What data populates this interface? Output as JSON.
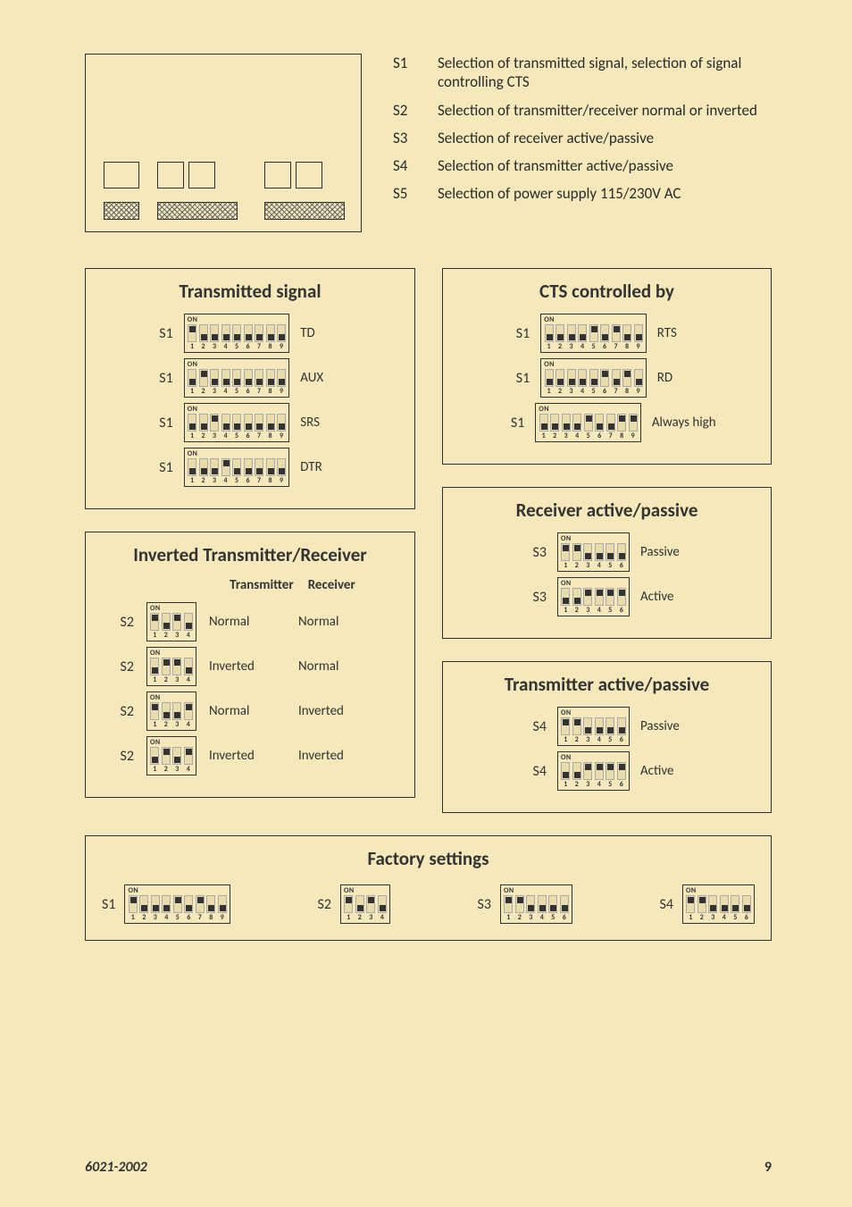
{
  "descriptions": [
    {
      "key": "S1",
      "text": "Selection of transmitted signal, selection of signal controlling CTS"
    },
    {
      "key": "S2",
      "text": "Selection of transmitter/receiver normal or inverted"
    },
    {
      "key": "S3",
      "text": "Selection of receiver active/passive"
    },
    {
      "key": "S4",
      "text": "Selection of transmitter active/passive"
    },
    {
      "key": "S5",
      "text": "Selection of power supply 115/230V AC"
    }
  ],
  "transmitted": {
    "title": "Transmitted signal",
    "rows": [
      {
        "label": "S1",
        "pattern": [
          1,
          0,
          0,
          0,
          0,
          0,
          0,
          0,
          0
        ],
        "result": "TD"
      },
      {
        "label": "S1",
        "pattern": [
          0,
          1,
          0,
          0,
          0,
          0,
          0,
          0,
          0
        ],
        "result": "AUX"
      },
      {
        "label": "S1",
        "pattern": [
          0,
          0,
          1,
          0,
          0,
          0,
          0,
          0,
          0
        ],
        "result": "SRS"
      },
      {
        "label": "S1",
        "pattern": [
          0,
          0,
          0,
          1,
          0,
          0,
          0,
          0,
          0
        ],
        "result": "DTR"
      }
    ]
  },
  "cts": {
    "title": "CTS controlled by",
    "rows": [
      {
        "label": "S1",
        "pattern": [
          0,
          0,
          0,
          0,
          1,
          0,
          1,
          0,
          0
        ],
        "result": "RTS"
      },
      {
        "label": "S1",
        "pattern": [
          0,
          0,
          0,
          0,
          0,
          1,
          0,
          1,
          0
        ],
        "result": "RD"
      },
      {
        "label": "S1",
        "pattern": [
          0,
          0,
          0,
          0,
          1,
          0,
          0,
          1,
          1
        ],
        "result": "Always high"
      }
    ]
  },
  "inverted": {
    "title": "Inverted Transmitter/Receiver",
    "headers": [
      "Transmitter",
      "Receiver"
    ],
    "rows": [
      {
        "label": "S2",
        "pattern": [
          1,
          0,
          1,
          0
        ],
        "tx": "Normal",
        "rx": "Normal"
      },
      {
        "label": "S2",
        "pattern": [
          0,
          1,
          1,
          0
        ],
        "tx": "Inverted",
        "rx": "Normal"
      },
      {
        "label": "S2",
        "pattern": [
          1,
          0,
          0,
          1
        ],
        "tx": "Normal",
        "rx": "Inverted"
      },
      {
        "label": "S2",
        "pattern": [
          0,
          1,
          0,
          1
        ],
        "tx": "Inverted",
        "rx": "Inverted"
      }
    ]
  },
  "rxap": {
    "title": "Receiver active/passive",
    "rows": [
      {
        "label": "S3",
        "pattern": [
          1,
          1,
          0,
          0,
          0,
          0
        ],
        "result": "Passive"
      },
      {
        "label": "S3",
        "pattern": [
          0,
          0,
          1,
          1,
          1,
          1
        ],
        "result": "Active"
      }
    ]
  },
  "txap": {
    "title": "Transmitter active/passive",
    "rows": [
      {
        "label": "S4",
        "pattern": [
          1,
          1,
          0,
          0,
          0,
          0
        ],
        "result": "Passive"
      },
      {
        "label": "S4",
        "pattern": [
          0,
          0,
          1,
          1,
          1,
          1
        ],
        "result": "Active"
      }
    ]
  },
  "factory": {
    "title": "Factory settings",
    "items": [
      {
        "label": "S1",
        "pattern": [
          1,
          0,
          0,
          0,
          1,
          0,
          1,
          0,
          0
        ]
      },
      {
        "label": "S2",
        "pattern": [
          1,
          0,
          1,
          0
        ]
      },
      {
        "label": "S3",
        "pattern": [
          1,
          1,
          0,
          0,
          0,
          0
        ]
      },
      {
        "label": "S4",
        "pattern": [
          1,
          1,
          0,
          0,
          0,
          0
        ]
      }
    ]
  },
  "on_label": "ON",
  "footer": {
    "doc": "6021-2002",
    "page": "9"
  }
}
